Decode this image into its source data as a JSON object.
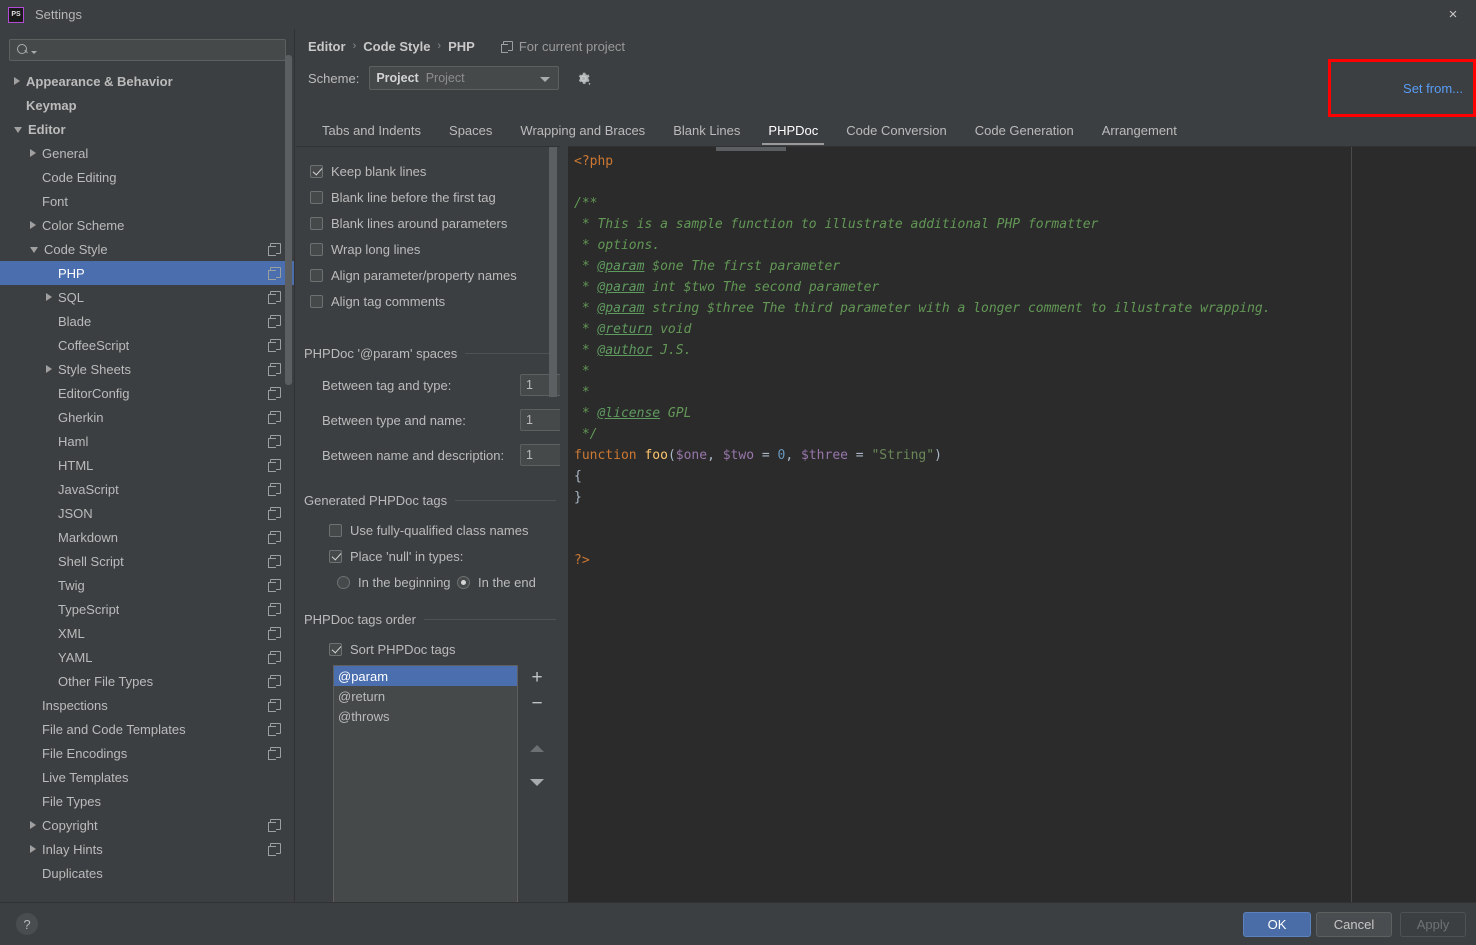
{
  "window": {
    "title": "Settings",
    "app_icon": "phpstorm-logo-icon",
    "close_label": "×"
  },
  "sidebar": {
    "search": {
      "value": "",
      "placeholder": "",
      "icon": "search-icon"
    },
    "items": [
      {
        "label": "Appearance & Behavior",
        "indent": 0,
        "arrow": "closed",
        "copy": false,
        "selected": false
      },
      {
        "label": "Keymap",
        "indent": 0,
        "arrow": "none",
        "copy": false,
        "selected": false
      },
      {
        "label": "Editor",
        "indent": 0,
        "arrow": "open",
        "copy": false,
        "selected": false
      },
      {
        "label": "General",
        "indent": 1,
        "arrow": "closed",
        "copy": false,
        "selected": false
      },
      {
        "label": "Code Editing",
        "indent": 1,
        "arrow": "none",
        "copy": false,
        "selected": false
      },
      {
        "label": "Font",
        "indent": 1,
        "arrow": "none",
        "copy": false,
        "selected": false
      },
      {
        "label": "Color Scheme",
        "indent": 1,
        "arrow": "closed",
        "copy": false,
        "selected": false
      },
      {
        "label": "Code Style",
        "indent": 1,
        "arrow": "open",
        "copy": true,
        "selected": false
      },
      {
        "label": "PHP",
        "indent": 2,
        "arrow": "none",
        "copy": true,
        "selected": true
      },
      {
        "label": "SQL",
        "indent": 2,
        "arrow": "closed",
        "copy": true,
        "selected": false
      },
      {
        "label": "Blade",
        "indent": 2,
        "arrow": "none",
        "copy": true,
        "selected": false
      },
      {
        "label": "CoffeeScript",
        "indent": 2,
        "arrow": "none",
        "copy": true,
        "selected": false
      },
      {
        "label": "Style Sheets",
        "indent": 2,
        "arrow": "closed",
        "copy": true,
        "selected": false
      },
      {
        "label": "EditorConfig",
        "indent": 2,
        "arrow": "none",
        "copy": true,
        "selected": false
      },
      {
        "label": "Gherkin",
        "indent": 2,
        "arrow": "none",
        "copy": true,
        "selected": false
      },
      {
        "label": "Haml",
        "indent": 2,
        "arrow": "none",
        "copy": true,
        "selected": false
      },
      {
        "label": "HTML",
        "indent": 2,
        "arrow": "none",
        "copy": true,
        "selected": false
      },
      {
        "label": "JavaScript",
        "indent": 2,
        "arrow": "none",
        "copy": true,
        "selected": false
      },
      {
        "label": "JSON",
        "indent": 2,
        "arrow": "none",
        "copy": true,
        "selected": false
      },
      {
        "label": "Markdown",
        "indent": 2,
        "arrow": "none",
        "copy": true,
        "selected": false
      },
      {
        "label": "Shell Script",
        "indent": 2,
        "arrow": "none",
        "copy": true,
        "selected": false
      },
      {
        "label": "Twig",
        "indent": 2,
        "arrow": "none",
        "copy": true,
        "selected": false
      },
      {
        "label": "TypeScript",
        "indent": 2,
        "arrow": "none",
        "copy": true,
        "selected": false
      },
      {
        "label": "XML",
        "indent": 2,
        "arrow": "none",
        "copy": true,
        "selected": false
      },
      {
        "label": "YAML",
        "indent": 2,
        "arrow": "none",
        "copy": true,
        "selected": false
      },
      {
        "label": "Other File Types",
        "indent": 2,
        "arrow": "none",
        "copy": true,
        "selected": false
      },
      {
        "label": "Inspections",
        "indent": 1,
        "arrow": "none",
        "copy": true,
        "selected": false
      },
      {
        "label": "File and Code Templates",
        "indent": 1,
        "arrow": "none",
        "copy": true,
        "selected": false
      },
      {
        "label": "File Encodings",
        "indent": 1,
        "arrow": "none",
        "copy": true,
        "selected": false
      },
      {
        "label": "Live Templates",
        "indent": 1,
        "arrow": "none",
        "copy": false,
        "selected": false
      },
      {
        "label": "File Types",
        "indent": 1,
        "arrow": "none",
        "copy": false,
        "selected": false
      },
      {
        "label": "Copyright",
        "indent": 1,
        "arrow": "closed",
        "copy": true,
        "selected": false
      },
      {
        "label": "Inlay Hints",
        "indent": 1,
        "arrow": "closed",
        "copy": true,
        "selected": false
      },
      {
        "label": "Duplicates",
        "indent": 1,
        "arrow": "none",
        "copy": false,
        "selected": false
      }
    ]
  },
  "header": {
    "breadcrumb": [
      "Editor",
      "Code Style",
      "PHP"
    ],
    "breadcrumb_separator": "›",
    "project_scope": "For current project",
    "project_scope_icon": "copy-icon",
    "scheme_label": "Scheme:",
    "scheme_value": "Project",
    "scheme_sub": "Project",
    "scheme_caret_icon": "chevron-down-icon",
    "gear_icon": "gear-icon",
    "set_from_label": "Set from..."
  },
  "tabs": [
    {
      "label": "Tabs and Indents",
      "active": false
    },
    {
      "label": "Spaces",
      "active": false
    },
    {
      "label": "Wrapping and Braces",
      "active": false
    },
    {
      "label": "Blank Lines",
      "active": false
    },
    {
      "label": "PHPDoc",
      "active": true
    },
    {
      "label": "Code Conversion",
      "active": false
    },
    {
      "label": "Code Generation",
      "active": false
    },
    {
      "label": "Arrangement",
      "active": false
    }
  ],
  "options": {
    "checkboxes": [
      {
        "label": "Keep blank lines",
        "checked": true
      },
      {
        "label": "Blank line before the first tag",
        "checked": false
      },
      {
        "label": "Blank lines around parameters",
        "checked": false
      },
      {
        "label": "Wrap long lines",
        "checked": false
      },
      {
        "label": "Align parameter/property names",
        "checked": false
      },
      {
        "label": "Align tag comments",
        "checked": false
      }
    ],
    "param_spaces_title": "PHPDoc '@param' spaces",
    "param_spaces_fields": [
      {
        "label": "Between tag and type:",
        "value": "1"
      },
      {
        "label": "Between type and name:",
        "value": "1"
      },
      {
        "label": "Between name and description:",
        "value": "1"
      }
    ],
    "generated_title": "Generated PHPDoc tags",
    "generated_checkboxes": [
      {
        "label": "Use fully-qualified class names",
        "checked": false
      },
      {
        "label": "Place 'null' in types:",
        "checked": true
      }
    ],
    "null_position_radios": [
      {
        "label": "In the beginning",
        "checked": false
      },
      {
        "label": "In the end",
        "checked": true
      }
    ],
    "tags_order_title": "PHPDoc tags order",
    "sort_tags": {
      "label": "Sort PHPDoc tags",
      "checked": true
    },
    "tags": [
      {
        "label": "@param",
        "selected": true
      },
      {
        "label": "@return",
        "selected": false
      },
      {
        "label": "@throws",
        "selected": false
      }
    ],
    "tag_buttons": {
      "add": "+",
      "remove": "−",
      "move_up_icon": "arrow-up-icon",
      "move_down_icon": "arrow-down-icon"
    }
  },
  "preview": {
    "lines": [
      [
        {
          "t": "<?php",
          "c": "c-tag"
        }
      ],
      [],
      [
        {
          "t": "/**",
          "c": "c-doc"
        }
      ],
      [
        {
          "t": " * This is a sample function to illustrate additional PHP formatter",
          "c": "c-doc"
        }
      ],
      [
        {
          "t": " * options.",
          "c": "c-doc"
        }
      ],
      [
        {
          "t": " * ",
          "c": "c-doc"
        },
        {
          "t": "@param",
          "c": "c-doctag"
        },
        {
          "t": " $one The first parameter",
          "c": "c-doc"
        }
      ],
      [
        {
          "t": " * ",
          "c": "c-doc"
        },
        {
          "t": "@param",
          "c": "c-doctag"
        },
        {
          "t": " int $two The second parameter",
          "c": "c-doc"
        }
      ],
      [
        {
          "t": " * ",
          "c": "c-doc"
        },
        {
          "t": "@param",
          "c": "c-doctag"
        },
        {
          "t": " string $three The third parameter with a longer comment to illustrate wrapping.",
          "c": "c-doc"
        }
      ],
      [
        {
          "t": " * ",
          "c": "c-doc"
        },
        {
          "t": "@return",
          "c": "c-doctag"
        },
        {
          "t": " void",
          "c": "c-doc"
        }
      ],
      [
        {
          "t": " * ",
          "c": "c-doc"
        },
        {
          "t": "@author",
          "c": "c-doctag"
        },
        {
          "t": " J.S.",
          "c": "c-doc"
        }
      ],
      [
        {
          "t": " *",
          "c": "c-doc"
        }
      ],
      [
        {
          "t": " *",
          "c": "c-doc"
        }
      ],
      [
        {
          "t": " * ",
          "c": "c-doc"
        },
        {
          "t": "@license",
          "c": "c-doctag"
        },
        {
          "t": " GPL",
          "c": "c-doc"
        }
      ],
      [
        {
          "t": " */",
          "c": "c-doc"
        }
      ],
      [
        {
          "t": "function",
          "c": "c-kw"
        },
        {
          "t": " ",
          "c": "c-plain"
        },
        {
          "t": "foo",
          "c": "c-fn"
        },
        {
          "t": "(",
          "c": "c-plain"
        },
        {
          "t": "$one",
          "c": "c-var"
        },
        {
          "t": ", ",
          "c": "c-plain"
        },
        {
          "t": "$two",
          "c": "c-var"
        },
        {
          "t": " = ",
          "c": "c-plain"
        },
        {
          "t": "0",
          "c": "c-num"
        },
        {
          "t": ", ",
          "c": "c-plain"
        },
        {
          "t": "$three",
          "c": "c-var"
        },
        {
          "t": " = ",
          "c": "c-plain"
        },
        {
          "t": "\"String\"",
          "c": "c-str"
        },
        {
          "t": ")",
          "c": "c-plain"
        }
      ],
      [
        {
          "t": "{",
          "c": "c-plain"
        }
      ],
      [
        {
          "t": "}",
          "c": "c-plain"
        }
      ],
      [],
      [],
      [
        {
          "t": "?>",
          "c": "c-tag"
        }
      ]
    ]
  },
  "footer": {
    "help_label": "?",
    "ok_label": "OK",
    "cancel_label": "Cancel",
    "apply_label": "Apply"
  },
  "colors": {
    "background": "#3c3f41",
    "editor_background": "#2b2b2b",
    "selection": "#4b6eaf",
    "link": "#589df6",
    "highlight_box": "#ff0000",
    "ok_button": "#4a6da7"
  }
}
